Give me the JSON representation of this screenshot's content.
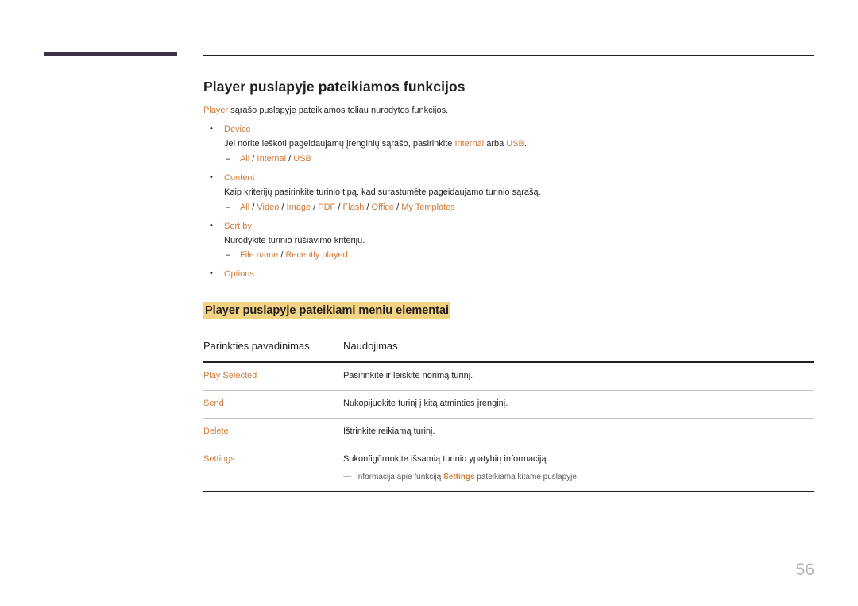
{
  "doc": {
    "page_number": "56",
    "section_title": "Player puslapyje pateikiamos funkcijos",
    "intro": {
      "lead": "Player",
      "rest": " sąrašo puslapyje pateikiamos toliau nurodytos funkcijos."
    },
    "bullets": [
      {
        "title": "Device",
        "desc_before": "Jei norite ieškoti pageidaujamų įrenginių sąrašo, pasirinkite ",
        "desc_accent1": "Internal",
        "desc_mid": " arba ",
        "desc_accent2": "USB",
        "desc_after": ".",
        "options": [
          "All",
          "Internal",
          "USB"
        ]
      },
      {
        "title": "Content",
        "desc": "Kaip kriterijų pasirinkite turinio tipą, kad surastumėte pageidaujamo turinio sąrašą.",
        "options": [
          "All",
          "Video",
          "Image",
          "PDF",
          "Flash",
          "Office",
          "My Templates"
        ]
      },
      {
        "title": "Sort by",
        "desc": "Nurodykite turinio rūšiavimo kriterijų.",
        "options": [
          "File name",
          "Recently played"
        ]
      },
      {
        "title": "Options",
        "desc": "",
        "options": []
      }
    ],
    "highlight_heading": "Player puslapyje pateikiami meniu elementai",
    "table": {
      "headers": [
        "Parinkties pavadinimas",
        "Naudojimas"
      ],
      "rows": [
        {
          "name": "Play Selected",
          "usage": "Pasirinkite ir leiskite norimą turinį."
        },
        {
          "name": "Send",
          "usage": "Nukopijuokite turinį į kitą atminties įrenginį."
        },
        {
          "name": "Delete",
          "usage": "Ištrinkite reikiamą turinį."
        },
        {
          "name": "Settings",
          "usage": "Sukonfigūruokite išsamią turinio ypatybių informaciją.",
          "note_before": "Informacija apie funkciją ",
          "note_bold": "Settings",
          "note_after": " pateikiama kitame puslapyje."
        }
      ]
    }
  }
}
